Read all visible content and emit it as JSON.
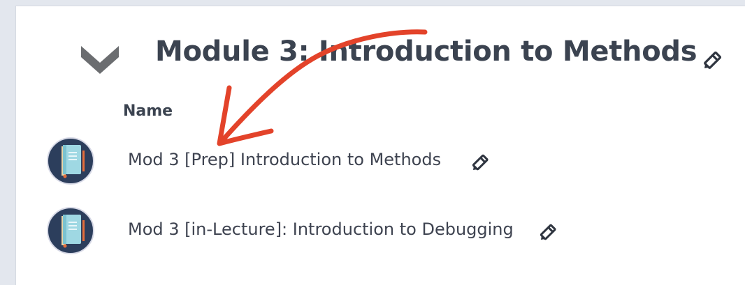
{
  "module": {
    "title": "Module 3: Introduction to Methods",
    "collapse_icon": "chevron-down-icon",
    "edit_icon": "pencil-icon"
  },
  "table": {
    "column_header": "Name",
    "items": [
      {
        "label": "Mod 3 [Prep] Introduction to Methods",
        "icon": "book-icon",
        "edit_icon": "pencil-icon"
      },
      {
        "label": "Mod 3 [in-Lecture]: Introduction to Debugging",
        "icon": "book-icon",
        "edit_icon": "pencil-icon"
      }
    ]
  },
  "colors": {
    "text": "#3b4350",
    "chevron": "#6b6d70",
    "annotation_arrow": "#e3432a",
    "avatar_bg": "#2c3e5c",
    "book_cover": "#9fd8e3"
  }
}
